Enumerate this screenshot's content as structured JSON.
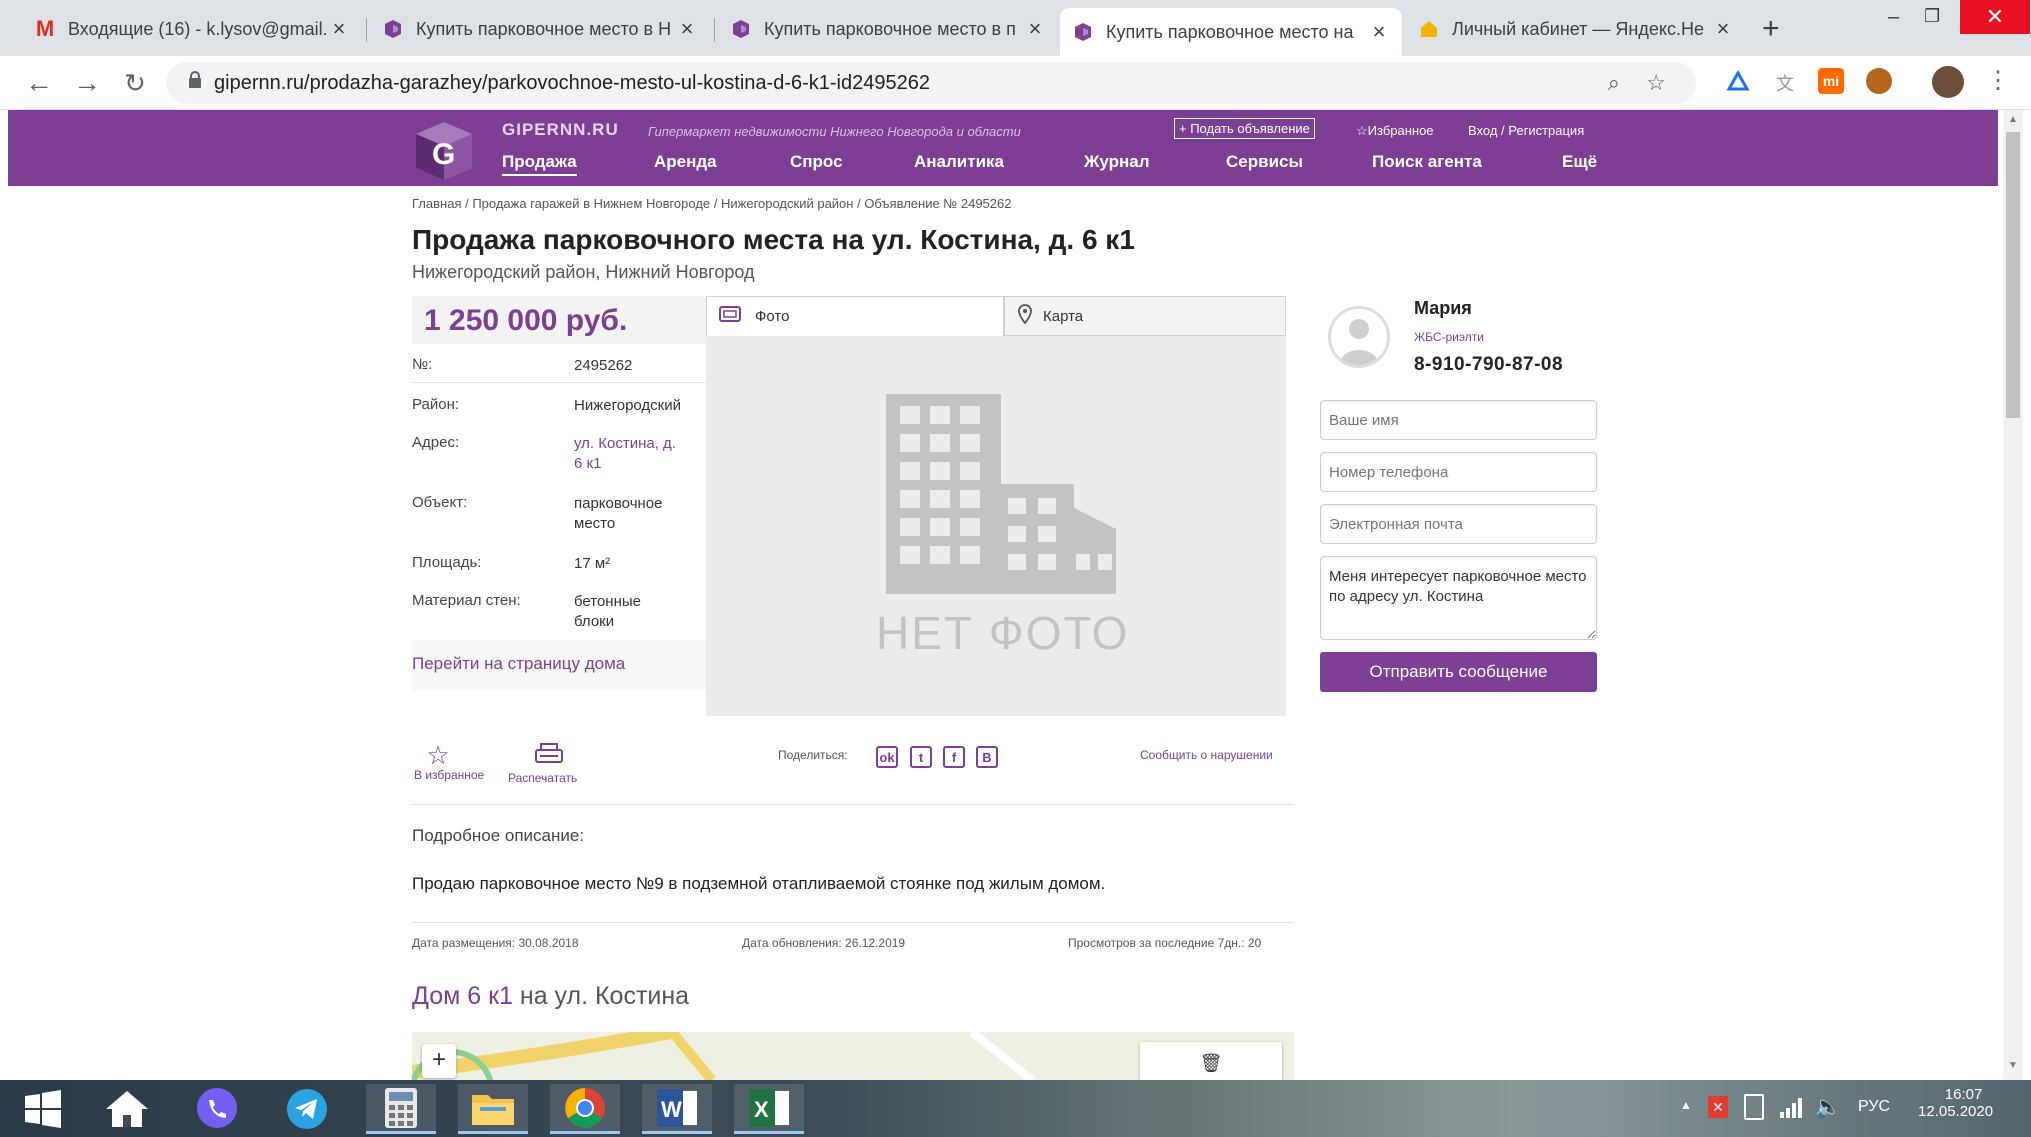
{
  "browser": {
    "tabs": [
      {
        "label": "Входящие (16) - k.lysov@gmail.",
        "icon": "gmail-icon",
        "active": false
      },
      {
        "label": "Купить парковочное место в Н",
        "icon": "gipernn-icon",
        "active": false
      },
      {
        "label": "Купить парковочное место в п",
        "icon": "gipernn-icon",
        "active": false
      },
      {
        "label": "Купить парковочное место на",
        "icon": "gipernn-icon",
        "active": true
      },
      {
        "label": "Личный кабинет — Яндекс.Не",
        "icon": "yandex-icon",
        "active": false
      }
    ],
    "url": "gipernn.ru/prodazha-garazhey/parkovochnoe-mesto-ul-kostina-d-6-k1-id2495262"
  },
  "site": {
    "logo_text": "GIPERNN.RU",
    "tagline": "Гипермаркет недвижимости Нижнего Новгорода и области",
    "add_listing": "+ Подать объявление",
    "favorites": "☆Избранное",
    "login": "Вход / Регистрация",
    "nav": [
      "Продажа",
      "Аренда",
      "Спрос",
      "Аналитика",
      "Журнал",
      "Сервисы",
      "Поиск агента",
      "Ещё"
    ],
    "accent_color": "#7c3f93"
  },
  "page": {
    "breadcrumb": "Главная / Продажа гаражей в Нижнем Новгороде / Нижегородский район / Объявление № 2495262",
    "title": "Продажа парковочного места на ул. Костина, д. 6 к1",
    "subtitle": "Нижегородский район, Нижний Новгород",
    "price": "1 250 000 руб.",
    "details": [
      {
        "label": "№:",
        "value": "2495262"
      },
      {
        "label": "Район:",
        "value": "Нижегородский"
      },
      {
        "label": "Адрес:",
        "value": "ул. Костина, д. 6 к1"
      },
      {
        "label": "Объект:",
        "value": "парковочное место"
      },
      {
        "label": "Площадь:",
        "value": "17 м²"
      },
      {
        "label": "Материал стен:",
        "value": "бетонные блоки"
      }
    ],
    "house_link": "Перейти на страницу дома",
    "tab_photo": "Фото",
    "tab_map": "Карта",
    "no_photo": "НЕТ ФОТО",
    "fav_label": "В избранное",
    "print_label": "Распечатать",
    "share_label": "Поделиться:",
    "report_label": "Сообщить о нарушении",
    "desc_heading": "Подробное описание:",
    "desc_text": "Продаю парковочное место №9 в подземной отапливаемой стоянке под жилым домом.",
    "date_posted": "Дата размещения: 30.08.2018",
    "date_updated": "Дата обновления: 26.12.2019",
    "views": "Просмотров за последние 7дн.: 20",
    "house_heading_bold": "Дом 6 к1",
    "house_heading_rest": " на ул. Костина"
  },
  "contact": {
    "name": "Мария",
    "agency": "ЖБС-риэлти",
    "phone": "8-910-790-87-08",
    "name_placeholder": "Ваше имя",
    "phone_placeholder": "Номер телефона",
    "email_placeholder": "Электронная почта",
    "message": "Меня интересует парковочное место по адресу ул. Костина",
    "send_button": "Отправить сообщение"
  },
  "taskbar": {
    "lang": "РУС",
    "time": "16:07",
    "date": "12.05.2020"
  }
}
